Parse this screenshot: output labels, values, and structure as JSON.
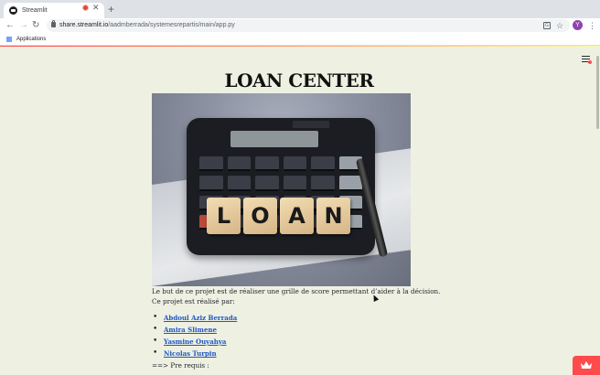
{
  "browser": {
    "tab_title": "Streamlit",
    "url_host": "share.streamlit.io",
    "url_path": "/aadmberrada/systemesrepartis/main/app.py",
    "profile_initial": "Y",
    "bookmarks_label": "Applications"
  },
  "page": {
    "title": "LOAN CENTER",
    "hero_tiles": [
      "L",
      "O",
      "A",
      "N"
    ],
    "description": "Le but de ce projet est de réaliser une grille de score permettant d’aider à la décision.",
    "team_intro": "Ce projet est réalisé par:",
    "team_members": [
      "Abdoul Aziz Berrada",
      "Amira Slimene",
      "Yasmine Ouyahya",
      "Nicolas Turpin"
    ],
    "prereq": "==> Pre requis :"
  },
  "colors": {
    "page_background": "#eef1e2",
    "link": "#1f56c2",
    "accent": "#ff4b4b"
  }
}
